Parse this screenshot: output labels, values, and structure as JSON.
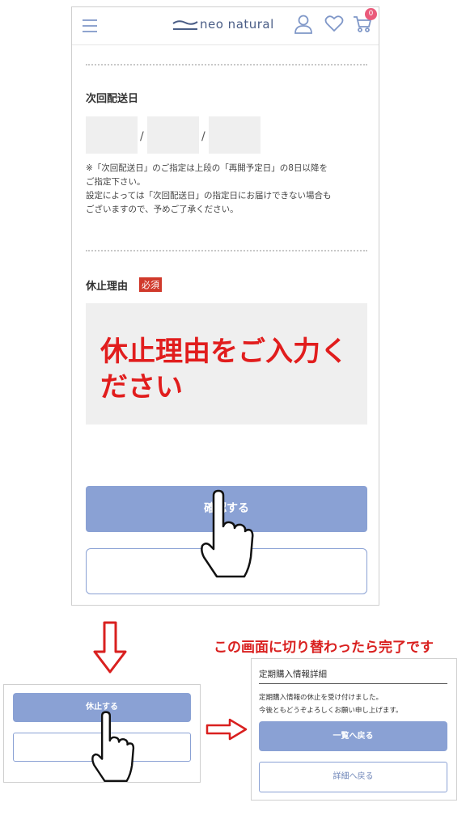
{
  "header": {
    "brand": "neo natural",
    "cart_count": "0"
  },
  "form": {
    "next_delivery_label": "次回配送日",
    "date_separator": "/",
    "note_lines": [
      "※「次回配送日」のご指定は上段の「再開予定日」の8日以降を",
      "ご指定下さい。",
      "設定によっては「次回配送日」の指定日にお届けできない場合も",
      "ございますので、予めご了承ください。"
    ],
    "reason_label": "休止理由",
    "required_badge": "必須",
    "reason_placeholder": "休止理由をご入力ください",
    "confirm_button": "確認する"
  },
  "step2": {
    "pause_button": "休止する"
  },
  "complete": {
    "caption": "この画面に切り替わったら完了です",
    "title": "定期購入情報詳細",
    "message_lines": [
      "定期購入情報の休止を受け付けました。",
      "今後ともどうぞよろしくお願い申し上げます。"
    ],
    "list_button": "一覧へ戻る",
    "detail_button": "詳細へ戻る"
  },
  "colors": {
    "accent": "#8aa1d4",
    "required": "#d0392b",
    "annotation": "#d9201f"
  },
  "icons": [
    "menu-icon",
    "logo-wave-icon",
    "user-icon",
    "heart-icon",
    "cart-icon",
    "hand-pointer-icon",
    "arrow-down-icon",
    "arrow-right-icon"
  ]
}
